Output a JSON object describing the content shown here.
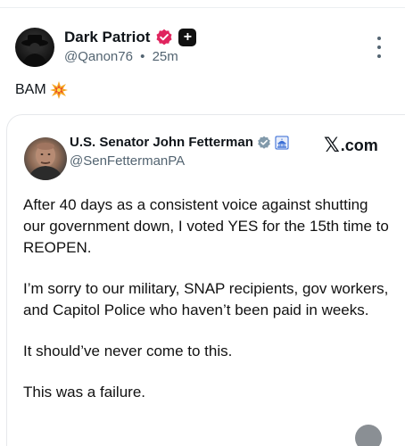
{
  "post": {
    "author": {
      "name": "Dark Patriot",
      "handle": "@Qanon76",
      "time_sep": "•",
      "time": "25m",
      "verified_color": "#e0245e"
    },
    "text": "BAM",
    "emoji": "boom-icon"
  },
  "quoted": {
    "author": {
      "name": "U.S. Senator John Fetterman",
      "handle": "@SenFettermanPA"
    },
    "source_brand": ".com",
    "paragraphs": [
      "After 40 days as a consistent voice against shutting our government down, I voted YES for the 15th time to REOPEN.",
      "I’m sorry to our military, SNAP recipients, gov workers, and Capitol Police who haven’t been paid in weeks.",
      "It should’ve never come to this.",
      "This was a failure."
    ]
  },
  "colors": {
    "text_primary": "#0f1419",
    "text_secondary": "#536471",
    "verified_pink": "#e0245e",
    "verified_gray": "#829aab",
    "capitol_blue": "#3b6fd6"
  }
}
